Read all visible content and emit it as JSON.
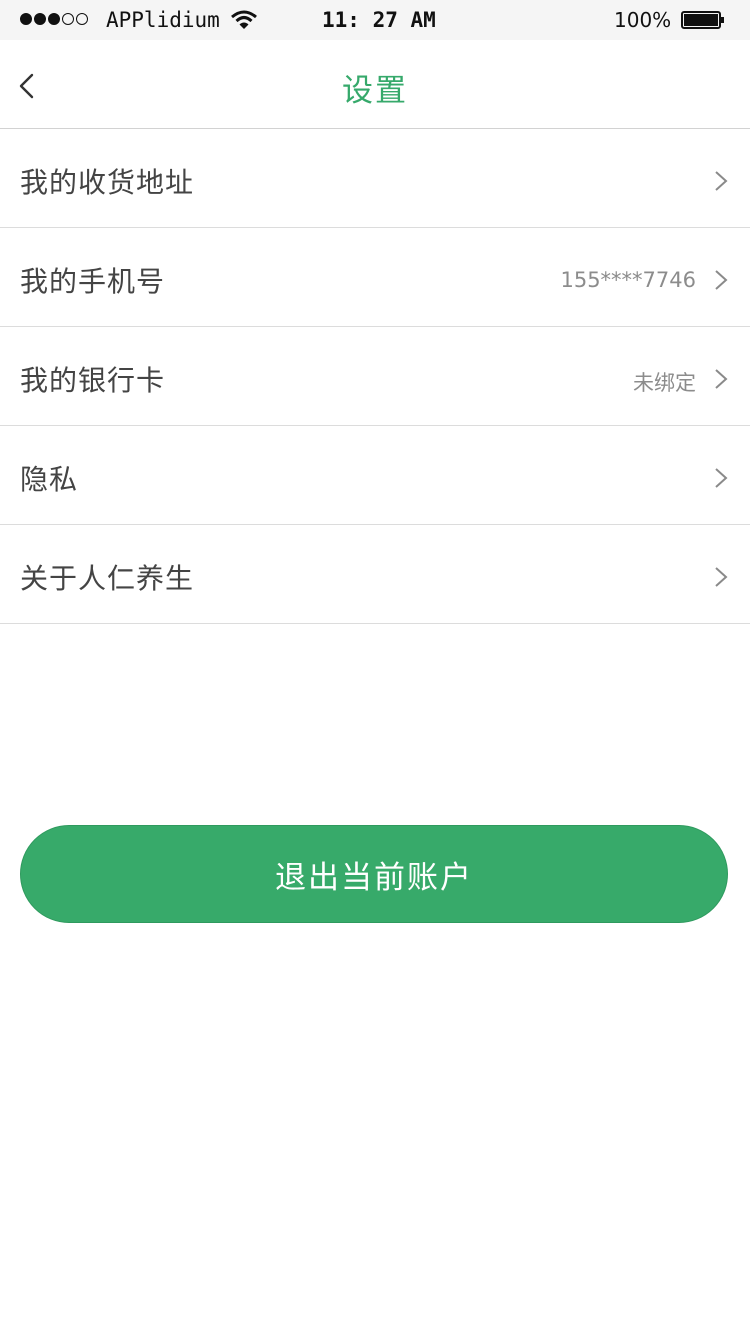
{
  "status_bar": {
    "carrier": "APPlidium",
    "time": "11: 27 AM",
    "battery": "100%",
    "signal_bars_filled": 3,
    "signal_bars_total": 5,
    "icons": [
      "wifi-icon",
      "battery-icon"
    ]
  },
  "nav": {
    "title": "设置",
    "back_icon": "chevron-left-icon"
  },
  "rows": [
    {
      "label": "我的收货地址",
      "value": ""
    },
    {
      "label": "我的手机号",
      "value": "155****7746"
    },
    {
      "label": "我的银行卡",
      "value": "未绑定"
    },
    {
      "label": "隐私",
      "value": ""
    },
    {
      "label": "关于人仁养生",
      "value": ""
    }
  ],
  "logout_label": "退出当前账户",
  "colors": {
    "accent": "#36a96b",
    "button": "#37aa6a",
    "divider": "#dcdcdc",
    "status_bar_bg": "#f5f5f5"
  }
}
